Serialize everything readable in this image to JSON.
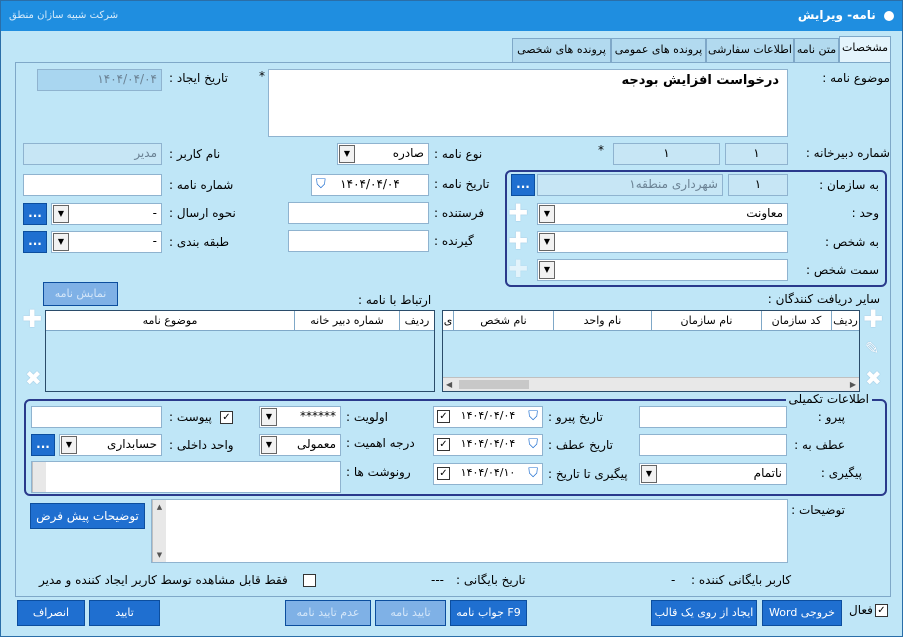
{
  "window": {
    "title": "نامه- ویرایش",
    "company": "شرکت شبیه سازان منطق"
  },
  "tabs": [
    "مشخصات",
    "متن نامه",
    "اطلاعات سفارشی",
    "پرونده های عمومی",
    "پرونده های شخصی"
  ],
  "form": {
    "subject_label": "موضوع نامه :",
    "subject_value": "درخواست افزایش بودجه",
    "created_date_label": "تاریخ ایجاد :",
    "created_date_value": "۱۴۰۴/۰۴/۰۴",
    "secretariat_label": "شماره دبیرخانه :",
    "secretariat_value_1": "۱",
    "secretariat_value_2": "۱",
    "letter_type_label": "نوع نامه :",
    "letter_type_value": "صادره",
    "username_label": "نام کاربر :",
    "username_value": "مدیر",
    "letter_date_label": "تاریخ نامه :",
    "letter_date_value": "۱۴۰۴/۰۴/۰۴",
    "letter_number_label": "شماره نامه :",
    "sender_label": "فرستنده :",
    "send_method_label": "نحوه ارسال :",
    "send_method_value": "-",
    "receiver_label": "گیرنده :",
    "classification_label": "طبقه بندی :",
    "classification_value": "-",
    "to_org_label": "به سازمان :",
    "to_org_code": "۱",
    "to_org_name": "شهرداری منطقه۱",
    "unit_label": "وحد :",
    "unit_value": "معاونت",
    "to_person_label": "به شخص :",
    "person_role_label": "سمت شخص :",
    "show_letter_btn": "نمایش نامه",
    "related_label": "ارتباط با نامه :",
    "other_recipients_label": "سایر دریافت کنندگان :",
    "related_cols": [
      "ردیف",
      "شماره دبیر خانه",
      "موضوع نامه"
    ],
    "recipient_cols": [
      "ردیف",
      "کد سازمان",
      "نام سازمان",
      "نام واحد",
      "نام شخص",
      "ی"
    ],
    "dots": "...",
    "required_mark": "*"
  },
  "extra": {
    "legend": "اطلاعات تکمیلی",
    "follow_label": "پیرو :",
    "follow_date_label": "تاریخ پیرو :",
    "follow_date_value": "۱۴۰۴/۰۴/۰۴",
    "priority_label": "اولویت :",
    "priority_value": "******",
    "attachment_label": "پیوست :",
    "refer_label": "عطف به :",
    "refer_date_label": "تاریخ عطف :",
    "refer_date_value": "۱۴۰۴/۰۴/۰۴",
    "importance_label": "درجه اهمیت :",
    "importance_value": "معمولی",
    "internal_unit_label": "واحد داخلی :",
    "internal_unit_value": "حسابداری",
    "tracking_label": "پیگیری :",
    "tracking_value": "ناتمام",
    "tracking_date_label": "پیگیری تا تاریخ :",
    "tracking_date_value": "۱۴۰۴/۰۴/۱۰",
    "cc_label": "رونوشت ها :"
  },
  "notes": {
    "label": "توضیحات :",
    "default_btn": "توضیحات پیش فرض",
    "archive_user_label": "کاربر بایگانی کننده :",
    "archive_user_value": "-",
    "archive_date_label": "تاریخ بایگانی :",
    "archive_date_value": "---",
    "visibility_label": "فقط قابل مشاهده توسط کاربر ایجاد کننده و مدیر"
  },
  "footer": {
    "active_label": "فعال",
    "word_btn": "خروجی Word",
    "template_btn": "ایجاد از روی یک قالب",
    "reply_btn": "F9 جواب نامه",
    "confirm_letter_btn": "تایید نامه",
    "reject_btn": "عدم تایید نامه",
    "ok_btn": "تایید",
    "cancel_btn": "انصراف"
  },
  "colors": {
    "titlebar": "#1f8ee0",
    "background": "#bfe6f7",
    "button": "#1f6fd0",
    "group_border": "#2a3a8c"
  }
}
